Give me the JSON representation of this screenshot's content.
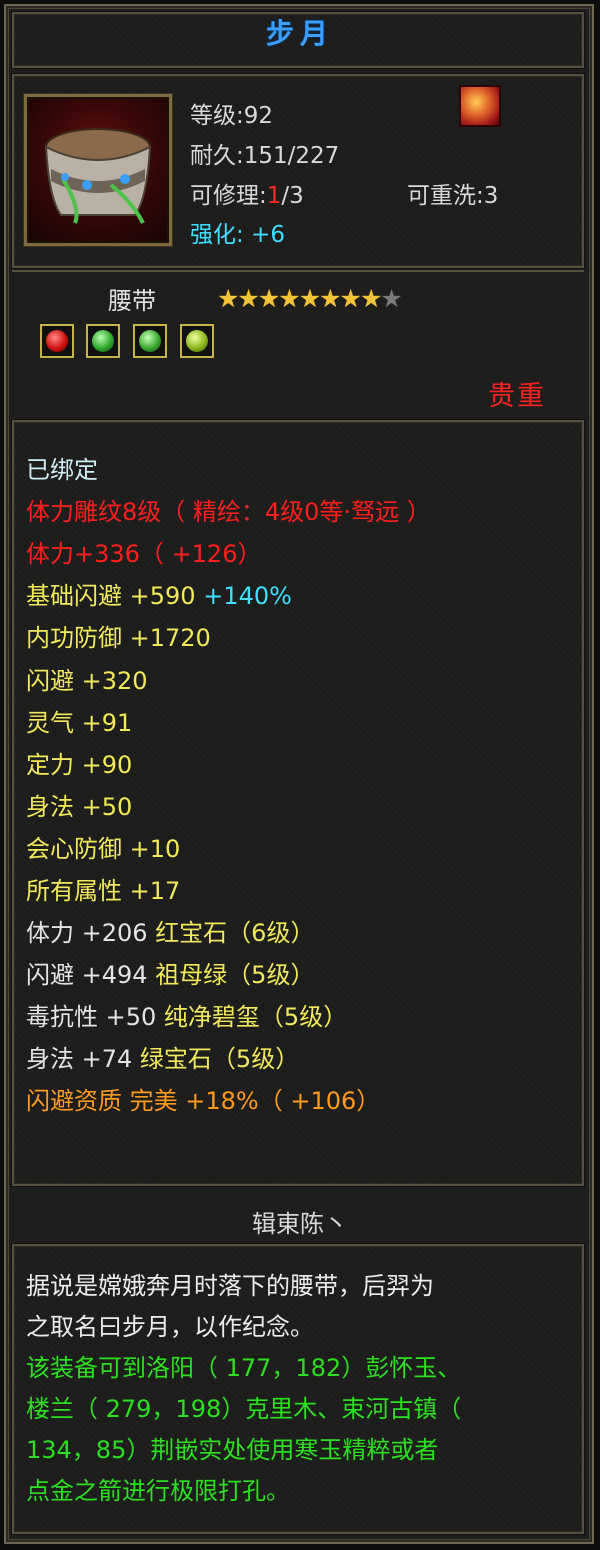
{
  "item": {
    "name": "步月",
    "level_line": "等级:92",
    "durability_line": "耐久:151/227",
    "repair_prefix": "可修理:",
    "repair_used": "1",
    "repair_total": "/3",
    "rewash_line": "可重洗:3",
    "enhance_line": "强化: +6",
    "type": "腰带",
    "stars_filled": 8,
    "stars_total": 9,
    "rarity": "贵重",
    "gem_slots": [
      "red-gem-icon",
      "green-gem-icon",
      "green-gem-icon",
      "green-yellow-gem-icon"
    ]
  },
  "stats": {
    "bound": "已绑定",
    "engrave": "体力雕纹8级（ 精绘：4级0等·驽远 ）",
    "stamina": "体力+336（ +126）",
    "base_dodge": "基础闪避 +590",
    "base_dodge_pct": "+140%",
    "inner_def": "内功防御 +1720",
    "dodge": "闪避 +320",
    "aura": "灵气 +91",
    "focus": "定力 +90",
    "agility": "身法 +50",
    "crit_def": "会心防御 +10",
    "all_attr": "所有属性 +17",
    "gem1_stat": "体力 +206",
    "gem1_name": "红宝石（6级）",
    "gem2_stat": "闪避 +494",
    "gem2_name": "祖母绿（5级）",
    "gem3_stat": "毒抗性 +50",
    "gem3_name": "纯净碧玺（5级）",
    "gem4_stat": "身法 +74",
    "gem4_name": "绿宝石（5级）",
    "quality": "闪避资质 完美 +18%（ +106）"
  },
  "maker": "辑東陈丶",
  "description": {
    "lore_1": "据说是嫦娥奔月时落下的腰带，后羿为",
    "lore_2": "之取名曰步月，以作纪念。",
    "hint_1": "该装备可到洛阳（ 177，182）彭怀玉、",
    "hint_2": "楼兰（ 279，198）克里木、束河古镇（",
    "hint_3": "134，85）荆嵌实处使用寒玉精粹或者",
    "hint_4": "点金之箭进行极限打孔。"
  },
  "colors": {
    "title": "#3aa0ff",
    "rarity": "#ff2222",
    "stat_yellow": "#f2e95a",
    "stat_red": "#ff1f1f",
    "stat_orange": "#ff9a1e",
    "hint_green": "#2ce020"
  }
}
